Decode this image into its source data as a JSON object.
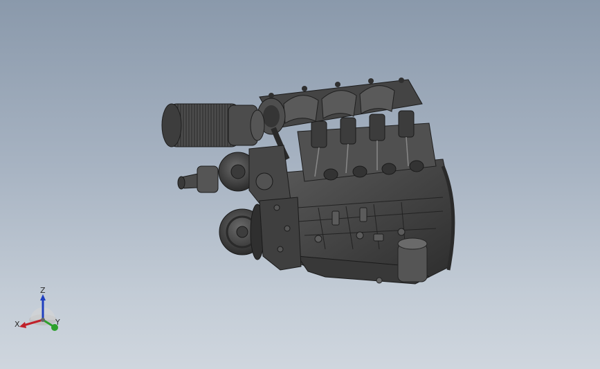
{
  "viewport": {
    "background_top": "#8a99ab",
    "background_bottom": "#cfd6de",
    "model_color": "#4a4a4a"
  },
  "triad": {
    "x_label": "X",
    "y_label": "Y",
    "z_label": "Z",
    "x_color": "#c0202a",
    "y_color": "#2ca02c",
    "z_color": "#1f3fbf"
  }
}
